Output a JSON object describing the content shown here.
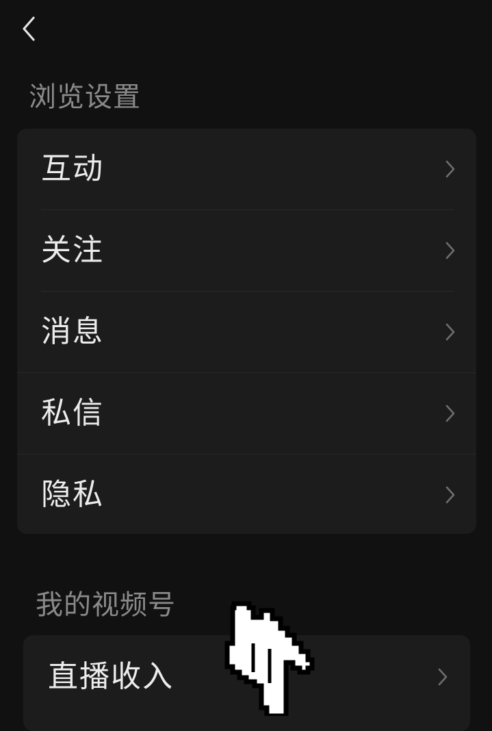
{
  "nav": {
    "back_icon": "chevron-left-icon"
  },
  "sections": [
    {
      "title": "浏览设置",
      "items": [
        {
          "label": "互动",
          "icon": "chevron-right-icon"
        },
        {
          "label": "关注",
          "icon": "chevron-right-icon"
        },
        {
          "label": "消息",
          "icon": "chevron-right-icon"
        },
        {
          "label": "私信",
          "icon": "chevron-right-icon"
        },
        {
          "label": "隐私",
          "icon": "chevron-right-icon"
        }
      ]
    },
    {
      "title": "我的视频号",
      "items": [
        {
          "label": "直播收入",
          "icon": "chevron-right-icon"
        }
      ]
    }
  ],
  "colors": {
    "background": "#111111",
    "card": "#1c1c1c",
    "section_title": "#8a8a8a",
    "item_text": "#ececec",
    "chevron": "#6e6e6e"
  },
  "overlay": {
    "cursor_icon": "hand-pointer-icon"
  }
}
